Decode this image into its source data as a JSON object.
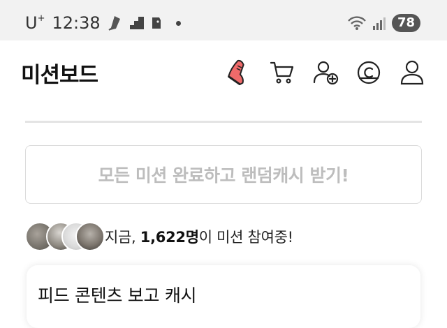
{
  "status_bar": {
    "carrier": "U",
    "carrier_sup": "+",
    "time": "12:38",
    "battery": "78",
    "icons": [
      "notification-icon",
      "stairs-icon",
      "sticker-icon",
      "dot-icon",
      "wifi-icon",
      "signal-icon"
    ]
  },
  "header": {
    "title": "미션보드",
    "icons": [
      "sneaker-icon",
      "cart-icon",
      "add-friend-icon",
      "coin-icon",
      "profile-icon"
    ]
  },
  "reward_button": {
    "label": "모든 미션 완료하고 랜덤캐시 받기!"
  },
  "participants": {
    "prefix": "지금, ",
    "count": "1,622명",
    "suffix": "이 미션 참여중!"
  },
  "feed_card": {
    "title": "피드 콘텐츠 보고 캐시"
  },
  "colors": {
    "status_bar_bg": "#f2f2f2",
    "accent_sneaker": "#f06a6a",
    "disabled_text": "#bdbdbd"
  }
}
